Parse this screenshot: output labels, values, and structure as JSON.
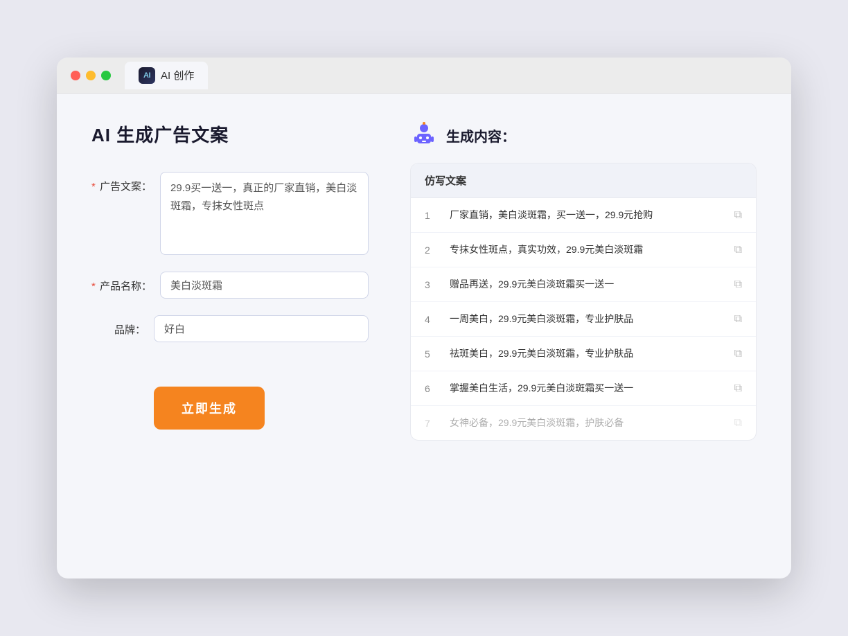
{
  "window": {
    "tab_label": "AI 创作"
  },
  "page": {
    "title": "AI 生成广告文案",
    "result_section_label": "生成内容："
  },
  "form": {
    "ad_copy_label": "广告文案：",
    "ad_copy_required": true,
    "ad_copy_value": "29.9买一送一，真正的厂家直销，美白淡斑霜，专抹女性斑点",
    "product_name_label": "产品名称：",
    "product_name_required": true,
    "product_name_value": "美白淡斑霜",
    "brand_label": "品牌：",
    "brand_required": false,
    "brand_value": "好白",
    "generate_button_label": "立即生成"
  },
  "results": {
    "column_header": "仿写文案",
    "items": [
      {
        "num": "1",
        "text": "厂家直销，美白淡斑霜，买一送一，29.9元抢购",
        "dimmed": false
      },
      {
        "num": "2",
        "text": "专抹女性斑点，真实功效，29.9元美白淡斑霜",
        "dimmed": false
      },
      {
        "num": "3",
        "text": "赠品再送，29.9元美白淡斑霜买一送一",
        "dimmed": false
      },
      {
        "num": "4",
        "text": "一周美白，29.9元美白淡斑霜，专业护肤品",
        "dimmed": false
      },
      {
        "num": "5",
        "text": "祛斑美白，29.9元美白淡斑霜，专业护肤品",
        "dimmed": false
      },
      {
        "num": "6",
        "text": "掌握美白生活，29.9元美白淡斑霜买一送一",
        "dimmed": false
      },
      {
        "num": "7",
        "text": "女神必备，29.9元美白淡斑霜，护肤必备",
        "dimmed": true
      }
    ]
  }
}
